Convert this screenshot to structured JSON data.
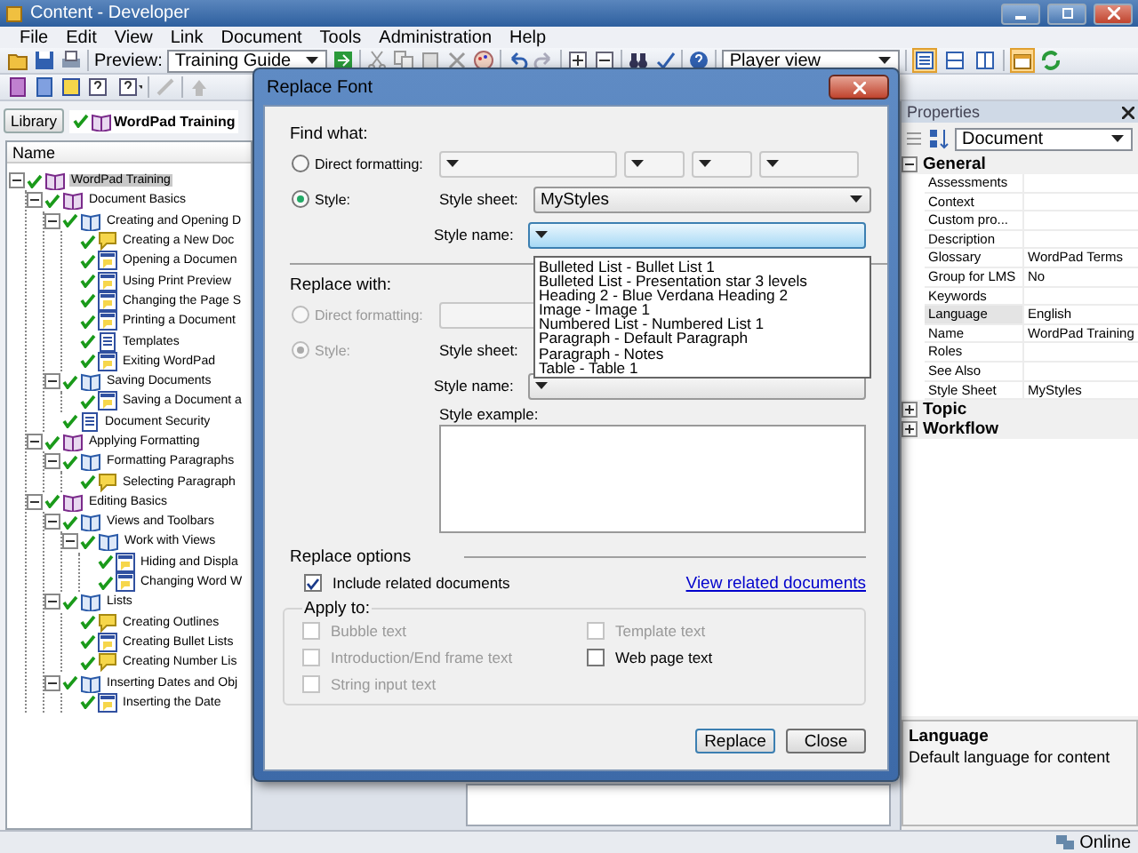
{
  "window": {
    "title": "Content - Developer"
  },
  "menu": [
    "File",
    "Edit",
    "View",
    "Link",
    "Document",
    "Tools",
    "Administration",
    "Help"
  ],
  "toolbar": {
    "preview_label": "Preview:",
    "preview_value": "Training Guide",
    "view_value": "Player view",
    "view_buttons": [
      {
        "on": true
      },
      {
        "on": false
      },
      {
        "on": false
      }
    ],
    "panel_toggle": {
      "on": true
    }
  },
  "library_tabs": [
    {
      "label": "Library",
      "selected": false
    },
    {
      "label": "WordPad Training",
      "selected": true
    }
  ],
  "tree": {
    "column": "Name",
    "items": [
      {
        "label": "WordPad Training",
        "kind": "module",
        "selected": true,
        "expanded": true,
        "children": [
          {
            "label": "Document Basics",
            "kind": "module",
            "selected": false,
            "expanded": true,
            "children": [
              {
                "label": "Creating and Opening D",
                "kind": "section",
                "selected": false,
                "expanded": true,
                "children": [
                  {
                    "label": "Creating a New Doc",
                    "kind": "bubble",
                    "selected": false
                  },
                  {
                    "label": "Opening a Documen",
                    "kind": "framed",
                    "selected": false
                  },
                  {
                    "label": "Using Print Preview",
                    "kind": "framed",
                    "selected": false
                  },
                  {
                    "label": "Changing the Page S",
                    "kind": "framed",
                    "selected": false
                  },
                  {
                    "label": "Printing a Document",
                    "kind": "framed",
                    "selected": false
                  },
                  {
                    "label": "Templates",
                    "kind": "document",
                    "selected": false
                  },
                  {
                    "label": "Exiting WordPad",
                    "kind": "framed",
                    "selected": false
                  }
                ]
              },
              {
                "label": "Saving Documents",
                "kind": "section",
                "selected": false,
                "expanded": true,
                "children": [
                  {
                    "label": "Saving a Document a",
                    "kind": "framed",
                    "selected": false
                  }
                ]
              },
              {
                "label": "Document Security",
                "kind": "document",
                "selected": false
              }
            ]
          },
          {
            "label": "Applying Formatting",
            "kind": "module",
            "selected": false,
            "expanded": true,
            "children": [
              {
                "label": "Formatting Paragraphs",
                "kind": "section",
                "selected": false,
                "expanded": true,
                "children": [
                  {
                    "label": "Selecting Paragraph",
                    "kind": "bubble",
                    "selected": false
                  }
                ]
              }
            ]
          },
          {
            "label": "Editing Basics",
            "kind": "module",
            "selected": false,
            "expanded": true,
            "children": [
              {
                "label": "Views and Toolbars",
                "kind": "section",
                "selected": false,
                "expanded": true,
                "children": [
                  {
                    "label": "Work with Views",
                    "kind": "section",
                    "selected": false,
                    "expanded": true,
                    "children": [
                      {
                        "label": "Hiding and Displa",
                        "kind": "framed",
                        "selected": false
                      },
                      {
                        "label": "Changing Word W",
                        "kind": "framed",
                        "selected": false
                      }
                    ]
                  }
                ]
              },
              {
                "label": "Lists",
                "kind": "section",
                "selected": false,
                "expanded": true,
                "children": [
                  {
                    "label": "Creating Outlines",
                    "kind": "bubble",
                    "selected": false
                  },
                  {
                    "label": "Creating Bullet Lists",
                    "kind": "framed",
                    "selected": false
                  },
                  {
                    "label": "Creating Number Lis",
                    "kind": "bubble",
                    "selected": false
                  }
                ]
              },
              {
                "label": "Inserting Dates and Obj",
                "kind": "section",
                "selected": false,
                "expanded": true,
                "children": [
                  {
                    "label": "Inserting the Date",
                    "kind": "framed",
                    "selected": false
                  }
                ]
              }
            ]
          }
        ]
      }
    ]
  },
  "dialog": {
    "title": "Replace Font",
    "find": {
      "heading": "Find what:",
      "options": [
        {
          "label": "Direct formatting:",
          "selected": false,
          "disabled": false
        },
        {
          "label": "Style:",
          "selected": true,
          "disabled": false
        }
      ],
      "style_sheet": {
        "label": "Style sheet:",
        "value": "MyStyles"
      },
      "style_name": {
        "label": "Style name:",
        "focused": true,
        "list": [
          "Bulleted List - Bullet List 1",
          "Bulleted List - Presentation star 3 levels",
          "Heading 2 - Blue Verdana Heading 2",
          "Image - Image 1",
          "Numbered List - Numbered List 1",
          "Paragraph - Default Paragraph",
          "Paragraph - Notes",
          "Table - Table 1"
        ]
      }
    },
    "replace": {
      "heading": "Replace with:",
      "options": [
        {
          "label": "Direct formatting:",
          "selected": false,
          "disabled": true
        },
        {
          "label": "Style:",
          "selected": true,
          "disabled": true
        }
      ],
      "style_sheet_label": "Style sheet:",
      "style_name_label": "Style name:",
      "example_label": "Style example:"
    },
    "replace_options": {
      "heading": "Replace options",
      "include": {
        "label": "Include related documents",
        "checked": true
      },
      "link": "View related documents",
      "apply_heading": "Apply to:",
      "apply": [
        {
          "label": "Bubble text",
          "checked": false,
          "disabled": true
        },
        {
          "label": "Template text",
          "checked": false,
          "disabled": true
        },
        {
          "label": "Introduction/End frame text",
          "checked": false,
          "disabled": true
        },
        {
          "label": "Web page text",
          "checked": false,
          "disabled": false
        },
        {
          "label": "String input text",
          "checked": false,
          "disabled": true
        }
      ]
    },
    "buttons": [
      {
        "label": "Replace",
        "default": true
      },
      {
        "label": "Close",
        "default": false
      }
    ]
  },
  "properties": {
    "title": "Properties",
    "object": "Document",
    "categories": [
      {
        "name": "General",
        "expanded": true,
        "rows": [
          {
            "name": "Assessments",
            "value": "",
            "selected": false
          },
          {
            "name": "Context",
            "value": "",
            "selected": false
          },
          {
            "name": "Custom pro...",
            "value": "",
            "selected": false
          },
          {
            "name": "Description",
            "value": "",
            "selected": false
          },
          {
            "name": "Glossary",
            "value": "WordPad Terms",
            "selected": false
          },
          {
            "name": "Group for LMS",
            "value": "No",
            "selected": false
          },
          {
            "name": "Keywords",
            "value": "",
            "selected": false
          },
          {
            "name": "Language",
            "value": "English",
            "selected": true
          },
          {
            "name": "Name",
            "value": "WordPad Training",
            "selected": false
          },
          {
            "name": "Roles",
            "value": "",
            "selected": false
          },
          {
            "name": "See Also",
            "value": "",
            "selected": false
          },
          {
            "name": "Style Sheet",
            "value": "MyStyles",
            "selected": false
          }
        ]
      },
      {
        "name": "Topic",
        "expanded": false
      },
      {
        "name": "Workflow",
        "expanded": false
      }
    ],
    "help_title": "Language",
    "help_text": "Default language for content"
  },
  "status_bar": {
    "text": "Online"
  }
}
